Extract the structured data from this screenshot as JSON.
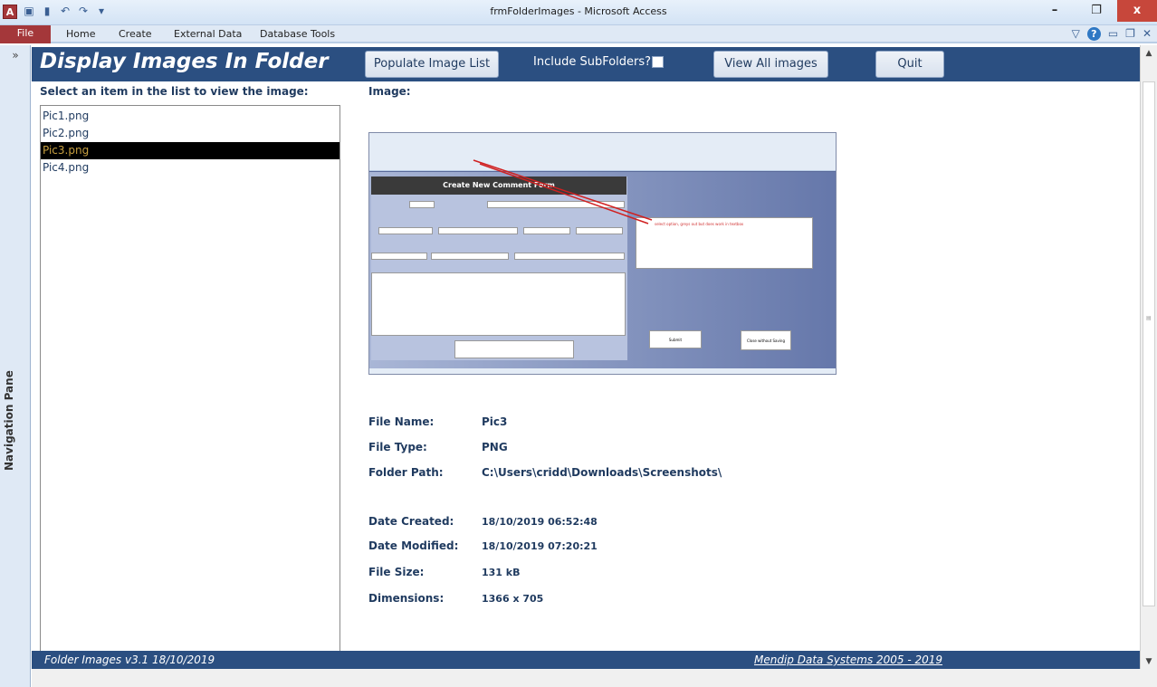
{
  "window": {
    "title": "frmFolderImages - Microsoft Access",
    "app_icon": "A",
    "minimize": "–",
    "restore": "❐",
    "close": "x"
  },
  "ribbon": {
    "file_label": "File",
    "tabs": [
      "Home",
      "Create",
      "External Data",
      "Database Tools"
    ]
  },
  "navpane": {
    "chevron": "»",
    "label": "Navigation Pane"
  },
  "header": {
    "title": "Display Images In Folder",
    "populate_label": "Populate Image List",
    "include_label": "Include SubFolders?",
    "include_checked": false,
    "view_all_label": "View All images",
    "quit_label": "Quit"
  },
  "list": {
    "label": "Select an item in the list to view the image:",
    "items": [
      "Pic1.png",
      "Pic2.png",
      "Pic3.png",
      "Pic4.png"
    ],
    "selected_index": 2
  },
  "image": {
    "label": "Image:",
    "preview": {
      "form_title": "Create New Comment Form",
      "note_text": "select option, greys out but does work in textbox",
      "submit": "Submit",
      "close_without_saving": "Close without Saving"
    }
  },
  "info": {
    "file_name_label": "File Name:",
    "file_name": "Pic3",
    "file_type_label": "File Type:",
    "file_type": "PNG",
    "folder_path_label": "Folder Path:",
    "folder_path": "C:\\Users\\cridd\\Downloads\\Screenshots\\",
    "date_created_label": "Date Created:",
    "date_created": "18/10/2019 06:52:48",
    "date_modified_label": "Date Modified:",
    "date_modified": "18/10/2019 07:20:21",
    "file_size_label": "File Size:",
    "file_size": "131 kB",
    "dimensions_label": "Dimensions:",
    "dimensions": "1366 x 705"
  },
  "footer": {
    "left": "Folder Images v3.1  18/10/2019",
    "right": "Mendip Data Systems 2005 - 2019"
  },
  "colors": {
    "header_bg": "#2b4f81",
    "file_tab": "#a4373a",
    "text_dark_blue": "#1f3a5f",
    "selected_bg": "#000000",
    "selected_fg": "#c8a040"
  }
}
